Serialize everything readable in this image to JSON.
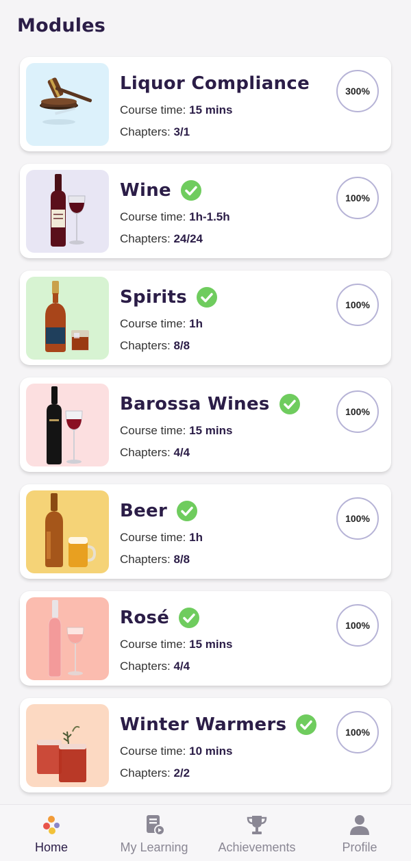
{
  "page": {
    "title": "Modules"
  },
  "modules": [
    {
      "title": "Liquor Compliance",
      "time_label": "Course time:",
      "time_value": "15 mins",
      "chapters_label": "Chapters:",
      "chapters_value": "3/1",
      "progress": "300%",
      "completed": false,
      "thumb_color": "#dcf1fb",
      "image": "gavel"
    },
    {
      "title": "Wine",
      "time_label": "Course time:",
      "time_value": "1h-1.5h",
      "chapters_label": "Chapters:",
      "chapters_value": "24/24",
      "progress": "100%",
      "completed": true,
      "thumb_color": "#e8e6f4",
      "image": "red-wine-bottle"
    },
    {
      "title": "Spirits",
      "time_label": "Course time:",
      "time_value": "1h",
      "chapters_label": "Chapters:",
      "chapters_value": "8/8",
      "progress": "100%",
      "completed": true,
      "thumb_color": "#d7f3d2",
      "image": "whisky-bottle"
    },
    {
      "title": "Barossa Wines",
      "time_label": "Course time:",
      "time_value": "15 mins",
      "chapters_label": "Chapters:",
      "chapters_value": "4/4",
      "progress": "100%",
      "completed": true,
      "thumb_color": "#fcdfe0",
      "image": "dark-wine-bottle"
    },
    {
      "title": "Beer",
      "time_label": "Course time:",
      "time_value": "1h",
      "chapters_label": "Chapters:",
      "chapters_value": "8/8",
      "progress": "100%",
      "completed": true,
      "thumb_color": "#f5d377",
      "image": "beer-bottle"
    },
    {
      "title": "Rosé",
      "time_label": "Course time:",
      "time_value": "15 mins",
      "chapters_label": "Chapters:",
      "chapters_value": "4/4",
      "progress": "100%",
      "completed": true,
      "thumb_color": "#fbbcaf",
      "image": "rose-bottle"
    },
    {
      "title": "Winter Warmers",
      "time_label": "Course time:",
      "time_value": "10 mins",
      "chapters_label": "Chapters:",
      "chapters_value": "2/2",
      "progress": "100%",
      "completed": true,
      "thumb_color": "#fcd9c2",
      "image": "cocktails"
    }
  ],
  "nav": {
    "items": [
      {
        "label": "Home",
        "icon": "home-icon",
        "active": true
      },
      {
        "label": "My Learning",
        "icon": "learning-icon",
        "active": false
      },
      {
        "label": "Achievements",
        "icon": "trophy-icon",
        "active": false
      },
      {
        "label": "Profile",
        "icon": "profile-icon",
        "active": false
      }
    ]
  },
  "colors": {
    "title": "#2b1d47",
    "check": "#6fcc5e",
    "ring": "#b6b3d6",
    "nav_muted": "#8a8794"
  }
}
